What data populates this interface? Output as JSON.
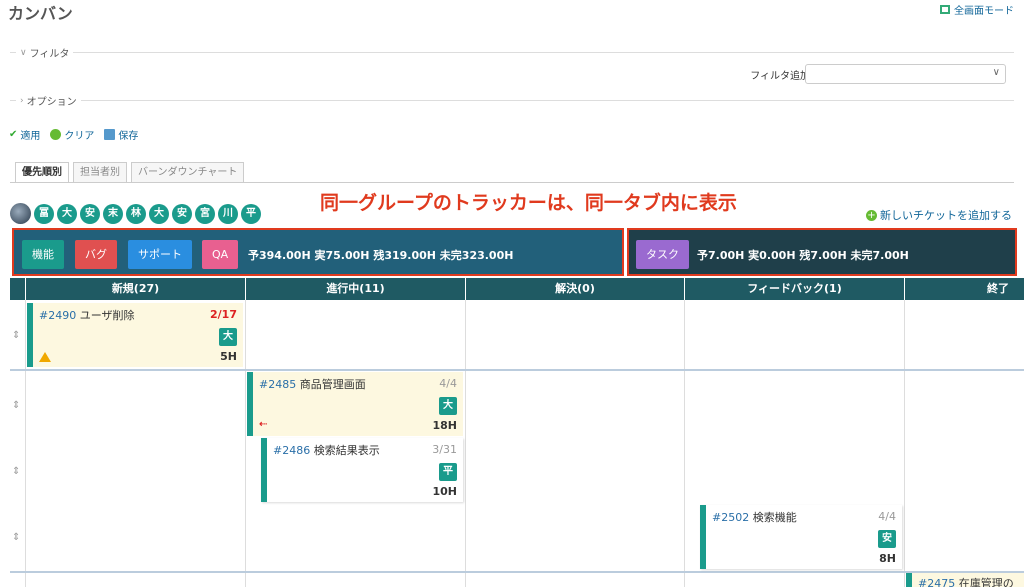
{
  "page": {
    "title": "カンバン",
    "fullscreen_label": "全画面モード"
  },
  "filter": {
    "section_label": "フィルタ",
    "add_label": "フィルタ追加",
    "select_value": ""
  },
  "options": {
    "section_label": "オプション"
  },
  "actions": {
    "apply": "適用",
    "clear": "クリア",
    "save": "保存"
  },
  "tabs": [
    "優先順別",
    "担当者別",
    "バーンダウンチャート"
  ],
  "avatars": [
    "冨",
    "大",
    "安",
    "末",
    "林",
    "大",
    "安",
    "宮",
    "川",
    "平"
  ],
  "annotation": "同一グループのトラッカーは、同一タブ内に表示",
  "new_ticket_label": "新しいチケットを追加する",
  "groups": [
    {
      "trackers": [
        {
          "label": "機能",
          "color": "#1a9b8c"
        },
        {
          "label": "バグ",
          "color": "#e05050"
        },
        {
          "label": "サポート",
          "color": "#2a8ee0"
        },
        {
          "label": "QA",
          "color": "#e86090"
        }
      ],
      "stats": "予394.00H 実75.00H 残319.00H 未完323.00H"
    },
    {
      "trackers": [
        {
          "label": "タスク",
          "color": "#9a6ad0"
        }
      ],
      "stats": "予7.00H 実0.00H 残7.00H 未完7.00H"
    }
  ],
  "columns": [
    "新規(27)",
    "進行中(11)",
    "解決(0)",
    "フィードバック(1)",
    "終了"
  ],
  "cards": [
    {
      "id": "#2490",
      "title": "ユーザ削除",
      "date": "2/17",
      "date_overdue": true,
      "badge": "大",
      "hours": "5H",
      "warning": true
    },
    {
      "id": "#2485",
      "title": "商品管理画面",
      "date": "4/4",
      "badge": "大",
      "hours": "18H",
      "link": true
    },
    {
      "id": "#2486",
      "title": "検索結果表示",
      "date": "3/31",
      "badge": "平",
      "hours": "10H"
    },
    {
      "id": "#2502",
      "title": "検索機能",
      "date": "4/4",
      "badge": "安",
      "hours": "8H"
    },
    {
      "id": "#2475",
      "title": "在庫管理の"
    }
  ],
  "colors": {
    "teal": "#1a9b8c",
    "header": "#1f5a63",
    "annotation": "#e03a1e",
    "link": "#169"
  }
}
